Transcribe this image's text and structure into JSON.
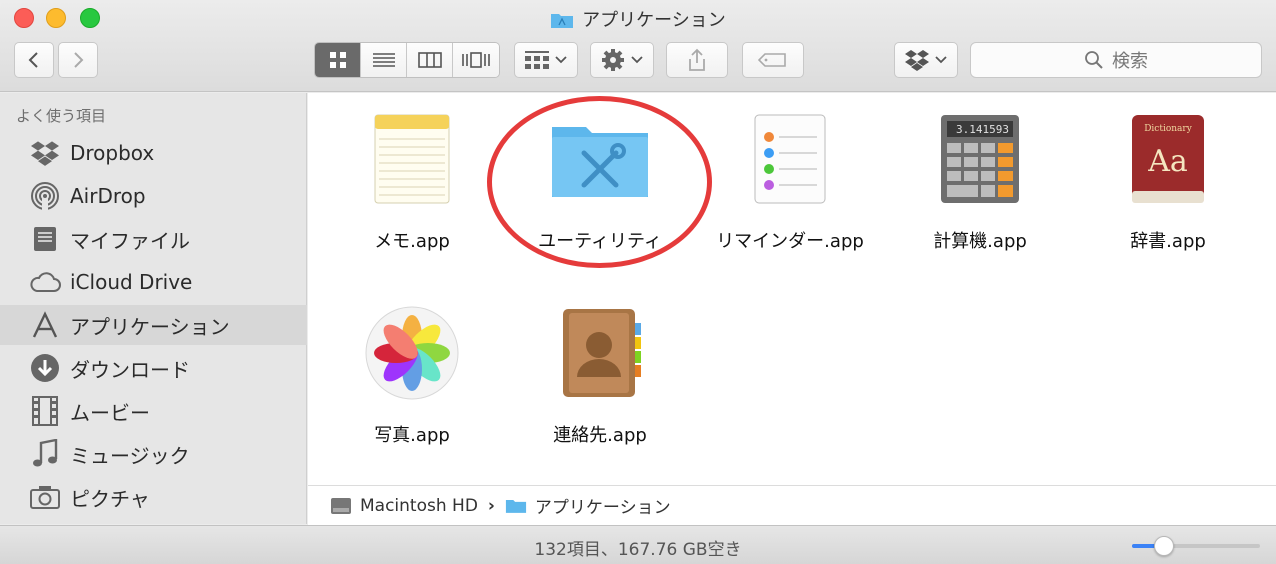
{
  "window": {
    "title": "アプリケーション"
  },
  "toolbar": {
    "search_placeholder": "検索"
  },
  "sidebar": {
    "header": "よく使う項目",
    "items": [
      {
        "label": "Dropbox"
      },
      {
        "label": "AirDrop"
      },
      {
        "label": "マイファイル"
      },
      {
        "label": "iCloud Drive"
      },
      {
        "label": "アプリケーション"
      },
      {
        "label": "ダウンロード"
      },
      {
        "label": "ムービー"
      },
      {
        "label": "ミュージック"
      },
      {
        "label": "ピクチャ"
      }
    ]
  },
  "apps": [
    {
      "label": "メモ.app",
      "icon": "notes-icon"
    },
    {
      "label": "ユーティリティ",
      "icon": "utilities-folder-icon"
    },
    {
      "label": "リマインダー.app",
      "icon": "reminders-icon"
    },
    {
      "label": "計算機.app",
      "icon": "calculator-icon"
    },
    {
      "label": "辞書.app",
      "icon": "dictionary-icon"
    },
    {
      "label": "写真.app",
      "icon": "photos-icon"
    },
    {
      "label": "連絡先.app",
      "icon": "contacts-icon"
    }
  ],
  "calculator_display": "3.141593",
  "dictionary_text": {
    "word": "Dictionary",
    "letters": "Aa"
  },
  "pathbar": {
    "disk": "Macintosh HD",
    "folder": "アプリケーション"
  },
  "status": {
    "text": "132項目、167.76 GB空き"
  },
  "zoom_slider": {
    "value": 0.25
  },
  "colors": {
    "accent": "#3b82f6",
    "highlight_ring": "#e53b3b",
    "folder_blue": "#5db7ec"
  }
}
